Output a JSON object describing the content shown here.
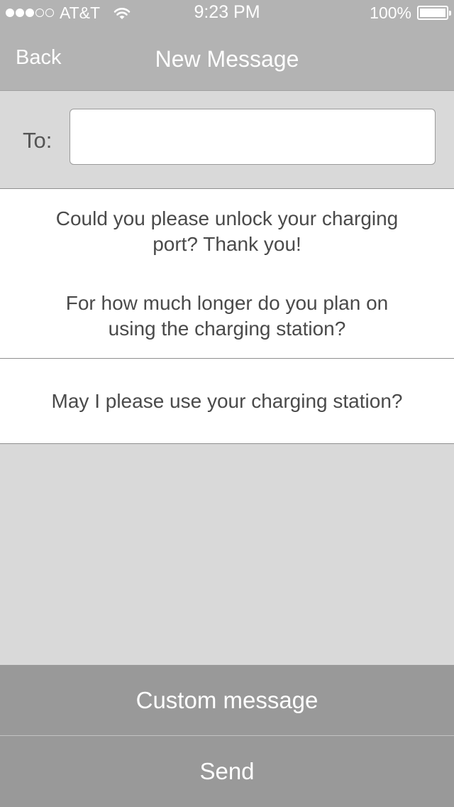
{
  "status_bar": {
    "carrier": "AT&T",
    "time": "9:23 PM",
    "battery_percent_text": "100%",
    "battery_level": 1.0,
    "signal_bars_filled": 3,
    "signal_bars_total": 5,
    "wifi_icon": "wifi-icon",
    "battery_icon": "battery-icon"
  },
  "nav": {
    "back_label": "Back",
    "title": "New Message"
  },
  "recipient": {
    "label": "To:",
    "value": "",
    "placeholder": ""
  },
  "messages": [
    {
      "line1": "Could you please unlock your charging",
      "line2": "port? Thank you!"
    },
    {
      "line1": "For how much longer do you plan on",
      "line2": "using the charging station?"
    },
    {
      "line1": "May I please use your charging station?"
    }
  ],
  "actions": {
    "custom_message_label": "Custom message",
    "send_label": "Send"
  },
  "colors": {
    "bar_background": "#b3b3b3",
    "page_background": "#d9d9d9",
    "button_background": "#999999",
    "text_primary": "#4a4a4a",
    "text_on_dark": "#ffffff"
  }
}
